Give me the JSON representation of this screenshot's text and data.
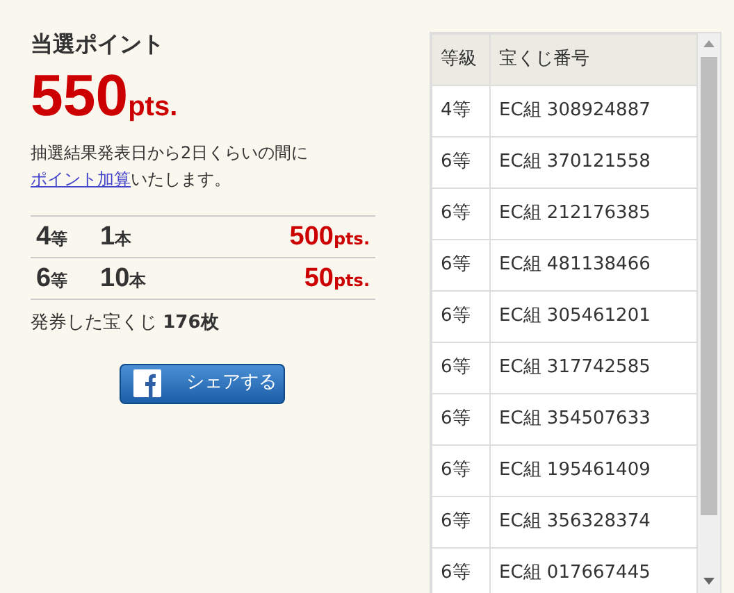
{
  "summary": {
    "title": "当選ポイント",
    "points_value": "550",
    "points_unit": "pts.",
    "note": {
      "before": "抽選結果発表日から2日くらいの間に",
      "link": "ポイント加算",
      "after": "いたします。"
    },
    "prizes": [
      {
        "grade": "4",
        "grade_unit": "等",
        "count": "1",
        "count_unit": "本",
        "points": "500",
        "points_unit": "pts."
      },
      {
        "grade": "6",
        "grade_unit": "等",
        "count": "10",
        "count_unit": "本",
        "points": "50",
        "points_unit": "pts."
      }
    ],
    "issued_label": "発券した宝くじ",
    "issued_count": "176枚",
    "share_button": "シェアする"
  },
  "table": {
    "columns": [
      "等級",
      "宝くじ番号"
    ],
    "rows": [
      [
        "4等",
        "EC組 308924887"
      ],
      [
        "6等",
        "EC組 370121558"
      ],
      [
        "6等",
        "EC組 212176385"
      ],
      [
        "6等",
        "EC組 481138466"
      ],
      [
        "6等",
        "EC組 305461201"
      ],
      [
        "6等",
        "EC組 317742585"
      ],
      [
        "6等",
        "EC組 354507633"
      ],
      [
        "6等",
        "EC組 195461409"
      ],
      [
        "6等",
        "EC組 356328374"
      ],
      [
        "6等",
        "EC組 017667445"
      ]
    ]
  }
}
